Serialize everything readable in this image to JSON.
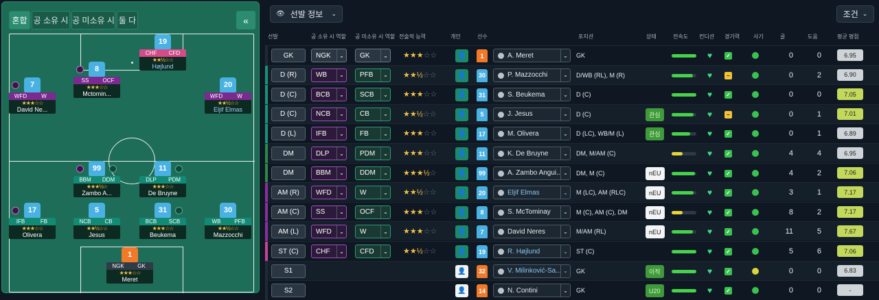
{
  "pitch": {
    "tabs": [
      "혼합",
      "공 소유 시",
      "공 미소유 시",
      "둘 다"
    ],
    "collapse_icon": "«",
    "players": [
      {
        "num": "19",
        "roles": [
          "CHF",
          "CFD"
        ],
        "stars": "★★½☆☆",
        "name": "Højlund",
        "link": true
      },
      {
        "num": "8",
        "roles": [
          "SS",
          "OCF"
        ],
        "stars": "★★★☆☆",
        "name": "Mctomin..."
      },
      {
        "num": "7",
        "roles": [
          "WFD",
          "W"
        ],
        "stars": "★★★☆☆",
        "name": "David Ne..."
      },
      {
        "num": "20",
        "roles": [
          "WFD",
          "W"
        ],
        "stars": "★★½☆☆",
        "name": "Eljif Elmas",
        "link": true
      },
      {
        "num": "99",
        "roles": [
          "BBM",
          "DDM"
        ],
        "stars": "★★★½☆",
        "name": "Zambo A..."
      },
      {
        "num": "11",
        "roles": [
          "DLP",
          "PDM"
        ],
        "stars": "★★★☆☆",
        "name": "De Bruyne"
      },
      {
        "num": "17",
        "roles": [
          "IFB",
          "FB"
        ],
        "stars": "★★★☆☆",
        "name": "Olivera"
      },
      {
        "num": "5",
        "roles": [
          "NCB",
          "CB"
        ],
        "stars": "★★½☆☆",
        "name": "Jesus"
      },
      {
        "num": "31",
        "roles": [
          "BCB",
          "SCB"
        ],
        "stars": "★★★☆☆",
        "name": "Beukema"
      },
      {
        "num": "30",
        "roles": [
          "WB",
          "PFB"
        ],
        "stars": "★★½☆☆",
        "name": "Mazzocchi"
      },
      {
        "num": "1",
        "roles": [
          "NGK",
          "GK"
        ],
        "stars": "★★★☆☆",
        "name": "Meret"
      }
    ]
  },
  "toolbar": {
    "info_label": "선발 정보",
    "cond_label": "조건"
  },
  "headers": {
    "pos": "선발",
    "ip": "공 소유 시 역할",
    "oop": "공 미소유 시 역할",
    "ability": "전술적 능력",
    "individual": "개인",
    "player": "선수",
    "position": "포지션",
    "status": "상태",
    "sharp": "전속도",
    "condition": "컨디션",
    "fitness": "경기력",
    "morale": "사기",
    "goals": "골",
    "assists": "도움",
    "rating": "평균 평점"
  },
  "rows": [
    {
      "pos": "GK",
      "ip": "NGK",
      "oop": "GK",
      "stars": "★★★",
      "empty": "☆☆",
      "num": "1",
      "gk": true,
      "name": "A. Meret",
      "position": "GK",
      "badge": "",
      "sharp": 1.0,
      "fit": "ok",
      "morale": "g",
      "goals": "0",
      "assists": "0",
      "rating": "6.95",
      "good": false,
      "stripe": "#1e2a35",
      "ind_white": false
    },
    {
      "pos": "D (R)",
      "ip": "WB",
      "oop": "PFB",
      "stars": "★★½",
      "empty": "☆☆",
      "num": "30",
      "gk": false,
      "name": "P. Mazzocchi",
      "position": "D/WB (RL), M (R)",
      "badge": "",
      "sharp": 0.85,
      "fit": "mid",
      "morale": "g",
      "goals": "0",
      "assists": "2",
      "rating": "6.90",
      "good": false,
      "stripe": "#17927a",
      "ind_white": false
    },
    {
      "pos": "D (C)",
      "ip": "BCB",
      "oop": "SCB",
      "stars": "★★★",
      "empty": "☆☆",
      "num": "31",
      "gk": false,
      "name": "S. Beukema",
      "position": "D (C)",
      "badge": "",
      "sharp": 1.0,
      "fit": "ok",
      "morale": "g",
      "goals": "0",
      "assists": "0",
      "rating": "7.05",
      "good": true,
      "stripe": "#17927a",
      "ind_white": false
    },
    {
      "pos": "D (C)",
      "ip": "NCB",
      "oop": "CB",
      "stars": "★★½",
      "empty": "☆☆",
      "num": "5",
      "gk": false,
      "name": "J. Jesus",
      "position": "D (C)",
      "badge": "관심",
      "badgeType": "g",
      "sharp": 0.9,
      "fit": "mid",
      "morale": "g",
      "goals": "0",
      "assists": "1",
      "rating": "7.01",
      "good": true,
      "stripe": "#17927a",
      "ind_white": false
    },
    {
      "pos": "D (L)",
      "ip": "IFB",
      "oop": "FB",
      "stars": "★★★",
      "empty": "☆☆",
      "num": "17",
      "gk": false,
      "name": "M. Olivera",
      "position": "D (LC), WB/M (L)",
      "badge": "관심",
      "badgeType": "g",
      "sharp": 0.75,
      "fit": "ok",
      "morale": "g",
      "goals": "0",
      "assists": "1",
      "rating": "6.89",
      "good": false,
      "stripe": "#17927a",
      "ind_white": false
    },
    {
      "pos": "DM",
      "ip": "DLP",
      "oop": "PDM",
      "stars": "★★★",
      "empty": "☆☆",
      "num": "11",
      "gk": false,
      "name": "K. De Bruyne",
      "position": "DM, M/AM (C)",
      "badge": "",
      "sharp": 0.45,
      "fit": "ok",
      "morale": "g",
      "goals": "4",
      "assists": "4",
      "rating": "6.95",
      "good": false,
      "stripe": "#2a8a4b",
      "ind_white": false
    },
    {
      "pos": "DM",
      "ip": "BBM",
      "oop": "DDM",
      "stars": "★★★½",
      "empty": "☆",
      "num": "99",
      "gk": false,
      "name": "A. Zambo Angui...",
      "position": "DM, M (C)",
      "badge": "nEU",
      "badgeType": "w",
      "sharp": 0.95,
      "fit": "ok",
      "morale": "g",
      "goals": "4",
      "assists": "2",
      "rating": "7.06",
      "good": true,
      "stripe": "#2a8a4b",
      "ind_white": false
    },
    {
      "pos": "AM (R)",
      "ip": "WFD",
      "oop": "W",
      "stars": "★★½",
      "empty": "☆☆",
      "num": "20",
      "gk": false,
      "name": "Eljif Elmas",
      "link": true,
      "position": "M (LC), AM (RLC)",
      "badge": "nEU",
      "badgeType": "w",
      "sharp": 0.9,
      "fit": "ok",
      "morale": "g",
      "goals": "3",
      "assists": "1",
      "rating": "7.17",
      "good": true,
      "stripe": "#8a2da0",
      "ind_white": false
    },
    {
      "pos": "AM (C)",
      "ip": "SS",
      "oop": "OCF",
      "stars": "★★★",
      "empty": "☆☆",
      "num": "8",
      "gk": false,
      "name": "S. McTominay",
      "position": "M (C), AM (C), DM",
      "badge": "nEU",
      "badgeType": "w",
      "sharp": 0.45,
      "fit": "ok",
      "morale": "g",
      "goals": "8",
      "assists": "2",
      "rating": "7.17",
      "good": true,
      "stripe": "#8a2da0",
      "ind_white": false
    },
    {
      "pos": "AM (L)",
      "ip": "WFD",
      "oop": "W",
      "stars": "★★★",
      "empty": "☆☆",
      "num": "7",
      "gk": false,
      "name": "David Neres",
      "position": "M/AM (RL)",
      "badge": "nEU",
      "badgeType": "w",
      "sharp": 0.85,
      "fit": "ok",
      "morale": "g",
      "goals": "11",
      "assists": "5",
      "rating": "7.67",
      "good": true,
      "stripe": "#8a2da0",
      "ind_white": false
    },
    {
      "pos": "ST (C)",
      "ip": "CHF",
      "oop": "CFD",
      "stars": "★★½",
      "empty": "☆☆",
      "num": "19",
      "gk": false,
      "name": "R. Højlund",
      "link": true,
      "position": "ST (C)",
      "badge": "",
      "sharp": 1.0,
      "fit": "ok",
      "morale": "g",
      "goals": "5",
      "assists": "6",
      "rating": "7.06",
      "good": true,
      "stripe": "#c8419a",
      "ind_white": false
    },
    {
      "pos": "S1",
      "ip": "",
      "oop": "",
      "stars": "",
      "empty": "",
      "num": "32",
      "gk": true,
      "name": "V. Milinković-Sa...",
      "link": true,
      "position": "GK",
      "badge": "이적",
      "badgeType": "g",
      "sharp": 1.0,
      "fit": "ok",
      "morale": "y",
      "goals": "0",
      "assists": "0",
      "rating": "6.83",
      "good": false,
      "stripe": "#1e2a35",
      "ind_white": true
    },
    {
      "pos": "S2",
      "ip": "",
      "oop": "",
      "stars": "",
      "empty": "",
      "num": "14",
      "gk": true,
      "name": "N. Contini",
      "position": "GK",
      "badge": "U20",
      "badgeType": "g",
      "sharp": 1.0,
      "fit": "ok",
      "morale": "g",
      "goals": "0",
      "assists": "0",
      "rating": "-",
      "good": false,
      "stripe": "#1e2a35",
      "ind_white": true
    }
  ]
}
